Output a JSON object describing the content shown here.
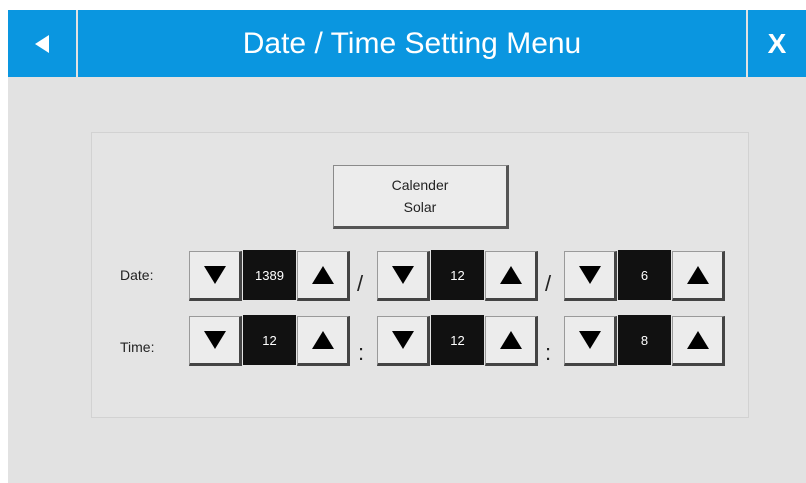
{
  "header": {
    "title": "Date / Time Setting Menu",
    "close_label": "X",
    "back_icon": "triangle-left-icon"
  },
  "mode": {
    "line1": "Calender",
    "line2": "Solar"
  },
  "date": {
    "label": "Date:",
    "separator": "/",
    "fields": [
      {
        "name": "year",
        "value": "1389"
      },
      {
        "name": "month",
        "value": "12"
      },
      {
        "name": "day",
        "value": "6"
      }
    ]
  },
  "time": {
    "label": "Time:",
    "separator": ":",
    "fields": [
      {
        "name": "hour",
        "value": "12"
      },
      {
        "name": "minute",
        "value": "12"
      },
      {
        "name": "second",
        "value": "8"
      }
    ]
  },
  "icons": {
    "decrement": "triangle-down-icon",
    "increment": "triangle-up-icon"
  },
  "colors": {
    "header_bg": "#0a96e0",
    "screen_bg": "#e2e2e2",
    "value_bg": "#111111"
  }
}
